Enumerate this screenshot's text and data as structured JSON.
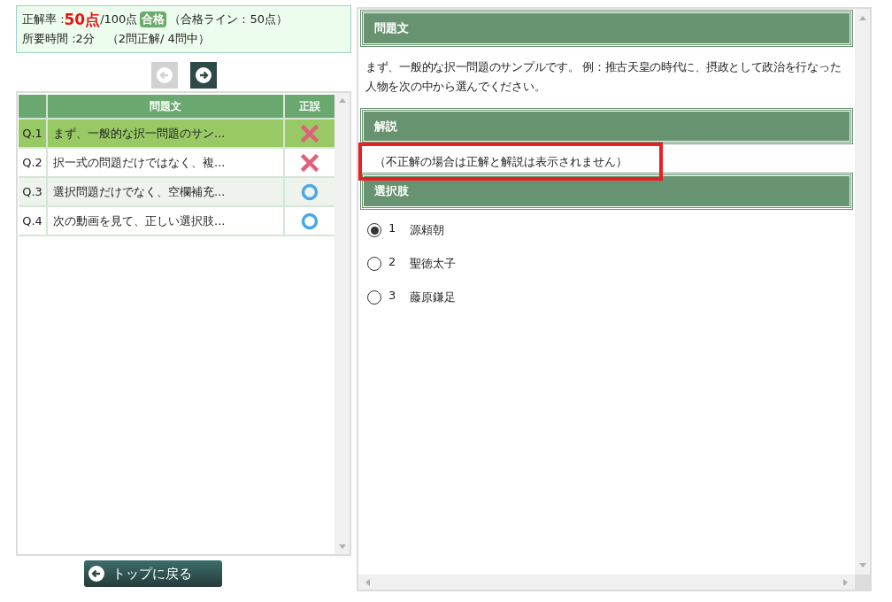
{
  "score": {
    "label": "正解率 : ",
    "value": "50点",
    "total": "/100点",
    "badge": "合格",
    "line": "（合格ライン：50点）",
    "time": "所要時間 :2分",
    "count": "（2問正解/ 4問中）"
  },
  "nav": {
    "prev_disabled": true,
    "next_disabled": false
  },
  "table": {
    "columns": [
      "問題文",
      "正誤"
    ],
    "rows": [
      {
        "no": "Q.1",
        "text": "まず、一般的な択一問題のサン...",
        "kind": "wrong",
        "selected": true
      },
      {
        "no": "Q.2",
        "text": "択一式の問題だけではなく、複...",
        "kind": "wrong",
        "selected": false
      },
      {
        "no": "Q.3",
        "text": "選択問題だけでなく、空欄補充...",
        "kind": "correct",
        "selected": false
      },
      {
        "no": "Q.4",
        "text": "次の動画を見て、正しい選択肢...",
        "kind": "correct",
        "selected": false
      }
    ]
  },
  "back_button": "トップに戻る",
  "question": {
    "heading": "問題文",
    "text": "まず、一般的な択一問題のサンプルです。 例：推古天皇の時代に、摂政として政治を行なった人物を次の中から選んでください。"
  },
  "explanation": {
    "heading": "解説",
    "text": "（不正解の場合は正解と解説は表示されません）",
    "highlighted": true
  },
  "choices": {
    "heading": "選択肢",
    "items": [
      {
        "no": "1",
        "label": "源頼朝",
        "selected": true
      },
      {
        "no": "2",
        "label": "聖徳太子",
        "selected": false
      },
      {
        "no": "3",
        "label": "藤原鎌足",
        "selected": false
      }
    ]
  }
}
